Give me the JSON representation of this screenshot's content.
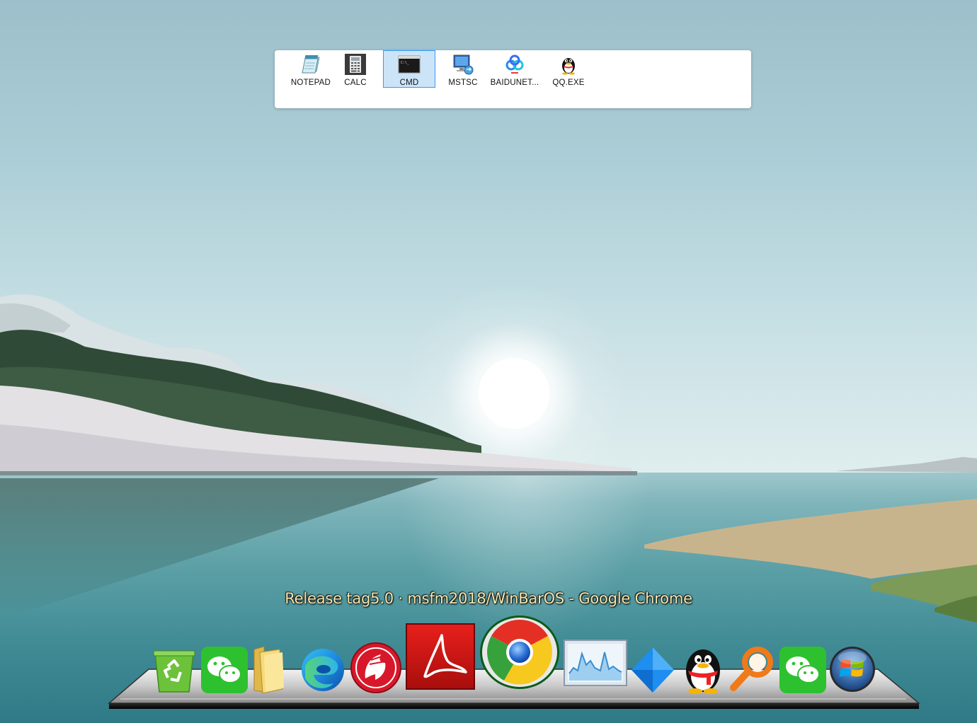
{
  "launcher": {
    "items": [
      {
        "label": "NOTEPAD",
        "icon": "notepad-icon",
        "selected": false
      },
      {
        "label": "CALC",
        "icon": "calculator-icon",
        "selected": false
      },
      {
        "label": "CMD",
        "icon": "command-prompt-icon",
        "selected": true
      },
      {
        "label": "MSTSC",
        "icon": "remote-desktop-icon",
        "selected": false
      },
      {
        "label": "BAIDUNET...",
        "icon": "baidu-netdisk-icon",
        "selected": false
      },
      {
        "label": "QQ.EXE",
        "icon": "qq-penguin-icon",
        "selected": false
      }
    ]
  },
  "dock": {
    "title": "Release tag5.0 · msfm2018/WinBarOS - Google Chrome",
    "items": [
      {
        "icon": "recycle-bin-icon"
      },
      {
        "icon": "wechat-icon"
      },
      {
        "icon": "folder-icon"
      },
      {
        "icon": "edge-browser-icon"
      },
      {
        "icon": "delphi-icon"
      },
      {
        "icon": "acrobat-reader-icon"
      },
      {
        "icon": "chrome-icon",
        "active": true
      },
      {
        "icon": "resource-monitor-icon"
      },
      {
        "icon": "blue-diamond-app-icon"
      },
      {
        "icon": "qq-penguin-icon"
      },
      {
        "icon": "search-magnifier-icon"
      },
      {
        "icon": "wechat-icon"
      },
      {
        "icon": "windows-start-icon"
      }
    ]
  },
  "colors": {
    "launcher_selected_bg": "#cce4f7",
    "launcher_selected_border": "#3399ff",
    "dock_title": "#f6e7b0"
  }
}
